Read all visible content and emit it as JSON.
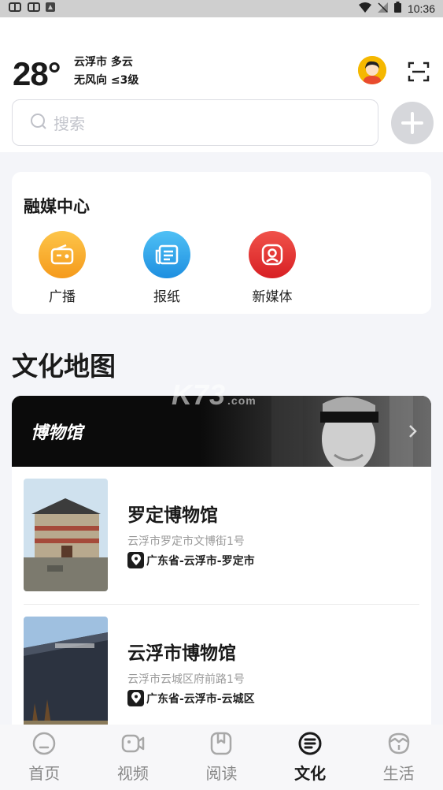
{
  "status_bar": {
    "time": "10:36"
  },
  "weather": {
    "temperature": "28°",
    "line1": "云浮市 多云",
    "line2": "无风向 ≤3级"
  },
  "search": {
    "placeholder": "搜索"
  },
  "media_center": {
    "title": "融媒中心",
    "items": [
      {
        "label": "广播",
        "icon": "radio-icon",
        "color": "#f6a623"
      },
      {
        "label": "报纸",
        "icon": "newspaper-icon",
        "color": "#2a9ee8"
      },
      {
        "label": "新媒体",
        "icon": "new-media-icon",
        "color": "#e8322e"
      }
    ]
  },
  "culture_map": {
    "title": "文化地图",
    "banner_title": "博物馆",
    "places": [
      {
        "name": "罗定博物馆",
        "address": "云浮市罗定市文博街1号",
        "region": "广东省-云浮市-罗定市"
      },
      {
        "name": "云浮市博物馆",
        "address": "云浮市云城区府前路1号",
        "region": "广东省-云浮市-云城区"
      }
    ]
  },
  "tabs": [
    {
      "label": "首页",
      "icon": "home-icon",
      "active": false
    },
    {
      "label": "视频",
      "icon": "video-icon",
      "active": false
    },
    {
      "label": "阅读",
      "icon": "reading-icon",
      "active": false
    },
    {
      "label": "文化",
      "icon": "culture-icon",
      "active": true
    },
    {
      "label": "生活",
      "icon": "life-icon",
      "active": false
    }
  ],
  "watermark": {
    "text": "K73",
    "suffix": ".com"
  },
  "colors": {
    "accent": "#e8322e",
    "background": "#f4f5f9"
  }
}
